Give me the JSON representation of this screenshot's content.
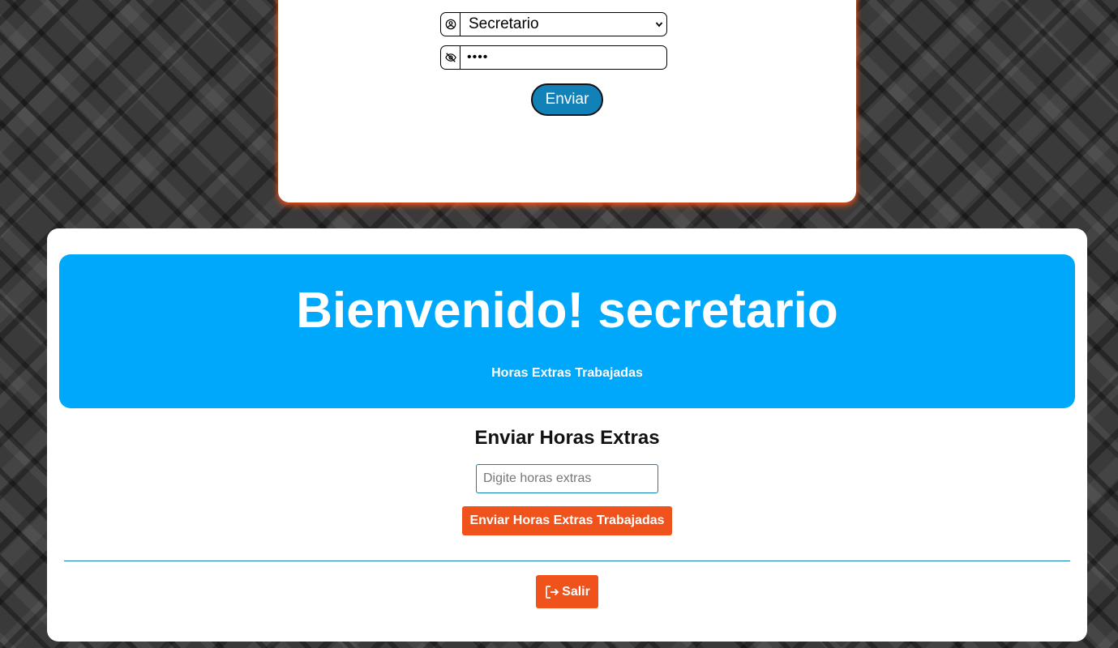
{
  "login": {
    "role_select_value": "Secretario",
    "password_masked": "••••",
    "submit_label": "Enviar"
  },
  "dashboard": {
    "welcome_title": "Bienvenido! secretario",
    "welcome_subtitle": "Horas Extras Trabajadas",
    "section_title": "Enviar Horas Extras",
    "hours_input_placeholder": "Digite horas extras",
    "hours_input_value": "",
    "submit_hours_label": "Enviar Horas Extras Trabajadas",
    "logout_label": "Salir"
  },
  "colors": {
    "hero_bg": "#00a8fb",
    "accent_orange": "#f0521b",
    "accent_blue": "#1181b8"
  },
  "icons": {
    "user": "user-circle-icon",
    "password": "eye-slash-icon",
    "dropdown": "chevron-down-icon",
    "logout": "sign-out-icon"
  }
}
